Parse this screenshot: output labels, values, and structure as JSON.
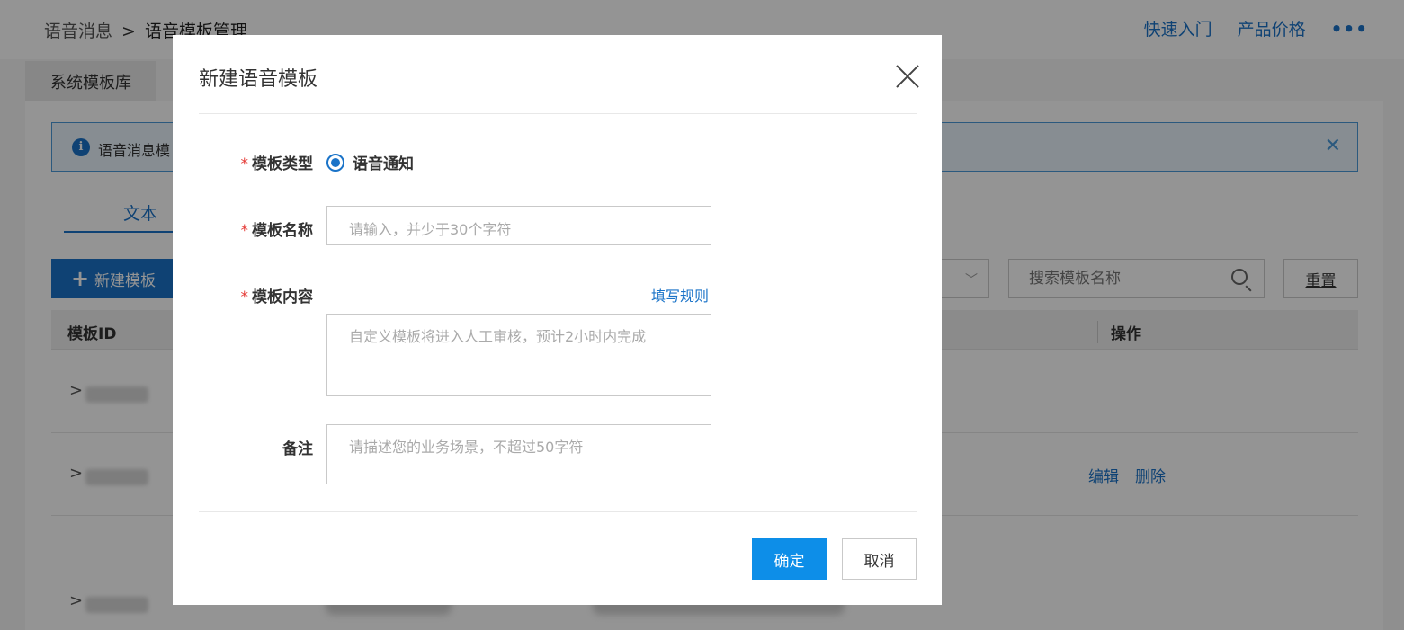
{
  "page": {
    "breadcrumb": {
      "parent": "语音消息",
      "separator": ">",
      "current": "语音模板管理"
    },
    "top_links": {
      "quick_start": "快速入门",
      "pricing": "产品价格",
      "more": "•••"
    },
    "tabs": {
      "system_library": "系统模板库"
    },
    "notice": {
      "text": "语音消息模",
      "close": "✕"
    },
    "subtab": {
      "text": "文本"
    },
    "toolbar": {
      "new_template": "新建模板",
      "search_placeholder": "搜索模板名称",
      "reset": "重置"
    },
    "table": {
      "col_id": "模板ID",
      "col_ops": "操作",
      "row_ops": {
        "edit": "编辑",
        "delete": "删除"
      }
    }
  },
  "modal": {
    "title": "新建语音模板",
    "fields": {
      "type": {
        "label": "模板类型",
        "option": "语音通知"
      },
      "name": {
        "label": "模板名称",
        "placeholder": "请输入，并少于30个字符"
      },
      "content": {
        "label": "模板内容",
        "placeholder": "自定义模板将进入人工审核，预计2小时内完成",
        "rule_link": "填写规则"
      },
      "remark": {
        "label": "备注",
        "placeholder": "请描述您的业务场景，不超过50字符"
      }
    },
    "required_mark": "*",
    "buttons": {
      "ok": "确定",
      "cancel": "取消"
    }
  },
  "colors": {
    "primary": "#1a73c8",
    "ok_button": "#0d8ee8",
    "required": "#e53935"
  }
}
